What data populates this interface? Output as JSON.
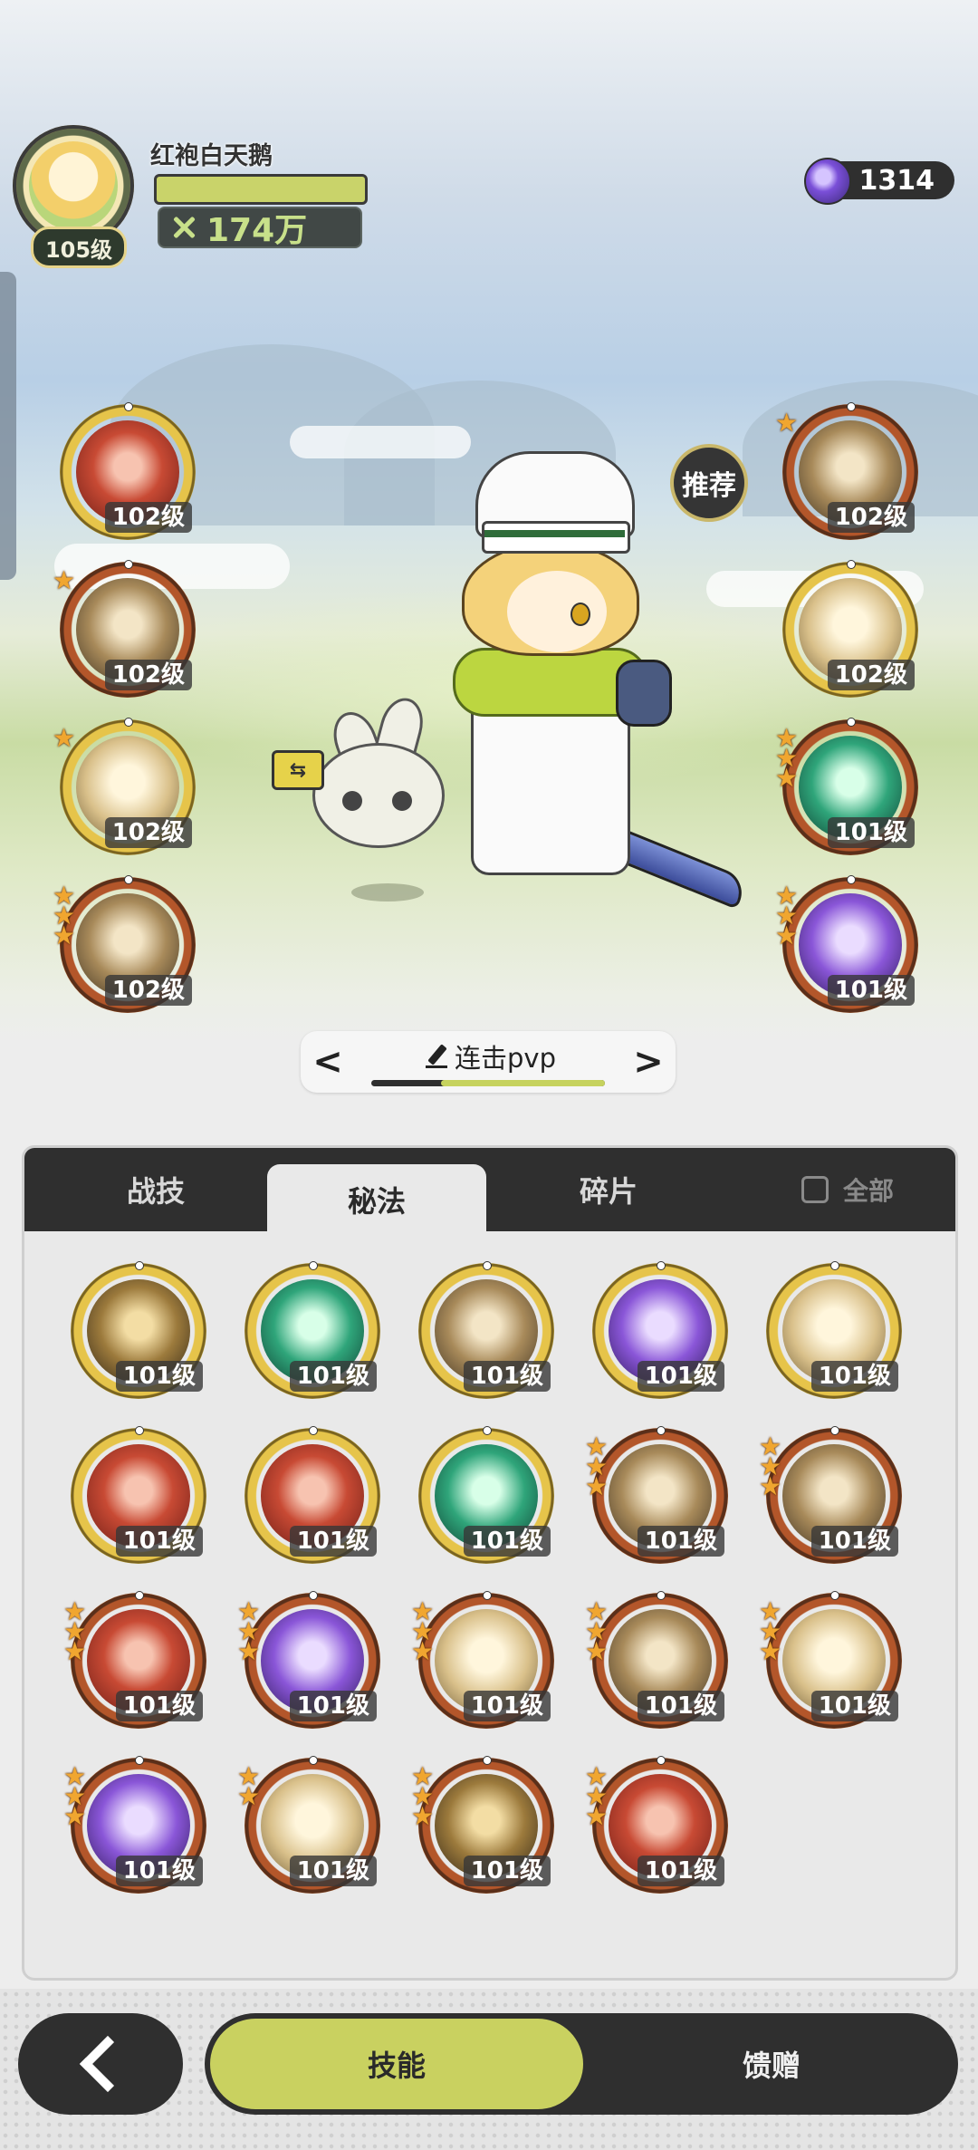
{
  "player": {
    "name": "红袍白天鹅",
    "level": "105级",
    "power": "174万",
    "hp_fraction": 1.0
  },
  "currency": {
    "icon": "purple-gem-icon",
    "amount": "1314"
  },
  "equipped_left": [
    {
      "level": "102级",
      "stars": 0,
      "frame": "gold",
      "theme": "red",
      "icon": "strike-skill-icon"
    },
    {
      "level": "102级",
      "stars": 1,
      "frame": "orange",
      "theme": "tan",
      "icon": "whirl-skill-icon"
    },
    {
      "level": "102级",
      "stars": 1,
      "frame": "gold",
      "theme": "cream",
      "icon": "tornado-skill-icon"
    },
    {
      "level": "102级",
      "stars": 3,
      "frame": "orange",
      "theme": "tan",
      "icon": "hand-skill-icon"
    }
  ],
  "equipped_right": [
    {
      "level": "102级",
      "stars": 1,
      "frame": "orange",
      "theme": "tan",
      "icon": "crown-skill-icon"
    },
    {
      "level": "102级",
      "stars": 0,
      "frame": "gold",
      "theme": "cream",
      "icon": "eye-skill-icon"
    },
    {
      "level": "101级",
      "stars": 3,
      "frame": "orange",
      "theme": "green",
      "icon": "heal-skill-icon"
    },
    {
      "level": "101级",
      "stars": 3,
      "frame": "orange",
      "theme": "purple",
      "icon": "shadow-skill-icon"
    }
  ],
  "recommend_label": "推荐",
  "build": {
    "name": "连击pvp",
    "progress": 0.7
  },
  "tabs": [
    {
      "label": "战技",
      "active": false
    },
    {
      "label": "秘法",
      "active": true
    },
    {
      "label": "碎片",
      "active": false
    }
  ],
  "check_all_label": "全部",
  "grid": [
    {
      "level": "101级",
      "stars": 0,
      "frame": "gold",
      "theme": "bronze",
      "icon": "armor-icon"
    },
    {
      "level": "101级",
      "stars": 0,
      "frame": "gold",
      "theme": "green",
      "icon": "heart-icon"
    },
    {
      "level": "101级",
      "stars": 0,
      "frame": "gold",
      "theme": "tan",
      "icon": "claw-icon"
    },
    {
      "level": "101级",
      "stars": 0,
      "frame": "gold",
      "theme": "purple",
      "icon": "beast-icon"
    },
    {
      "level": "101级",
      "stars": 0,
      "frame": "gold",
      "theme": "cream",
      "icon": "sword-up-icon"
    },
    {
      "level": "101级",
      "stars": 0,
      "frame": "gold",
      "theme": "red",
      "icon": "sword-plus-icon"
    },
    {
      "level": "101级",
      "stars": 0,
      "frame": "gold",
      "theme": "red",
      "icon": "slash-icon"
    },
    {
      "level": "101级",
      "stars": 0,
      "frame": "gold",
      "theme": "green",
      "icon": "green-blade-icon"
    },
    {
      "level": "101级",
      "stars": 3,
      "frame": "orange",
      "theme": "tan",
      "icon": "dagger-icon"
    },
    {
      "level": "101级",
      "stars": 3,
      "frame": "orange",
      "theme": "tan",
      "icon": "shield-heart-icon"
    },
    {
      "level": "101级",
      "stars": 3,
      "frame": "orange",
      "theme": "red",
      "icon": "scroll-icon"
    },
    {
      "level": "101级",
      "stars": 3,
      "frame": "orange",
      "theme": "purple",
      "icon": "aura-icon"
    },
    {
      "level": "101级",
      "stars": 3,
      "frame": "orange",
      "theme": "cream",
      "icon": "burst-icon"
    },
    {
      "level": "101级",
      "stars": 3,
      "frame": "orange",
      "theme": "tan",
      "icon": "spiral-icon"
    },
    {
      "level": "101级",
      "stars": 3,
      "frame": "orange",
      "theme": "cream",
      "icon": "heal-golem-icon"
    },
    {
      "level": "101级",
      "stars": 3,
      "frame": "orange",
      "theme": "purple",
      "icon": "flame-icon"
    },
    {
      "level": "101级",
      "stars": 2,
      "frame": "orange",
      "theme": "cream",
      "icon": "blade-icon"
    },
    {
      "level": "101级",
      "stars": 3,
      "frame": "orange",
      "theme": "bronze",
      "icon": "golem-icon"
    },
    {
      "level": "101级",
      "stars": 3,
      "frame": "orange",
      "theme": "red",
      "icon": "red-armor-icon"
    }
  ],
  "bottom": {
    "back_icon": "back-chevron-icon",
    "skill_label": "技能",
    "gift_label": "馈赠",
    "active": "skill"
  },
  "colors": {
    "accent": "#c9d160",
    "dark": "#2f2f2f",
    "gold_frame": "#f1d35f",
    "orange_frame": "#e07c38",
    "star": "#f0a630"
  }
}
